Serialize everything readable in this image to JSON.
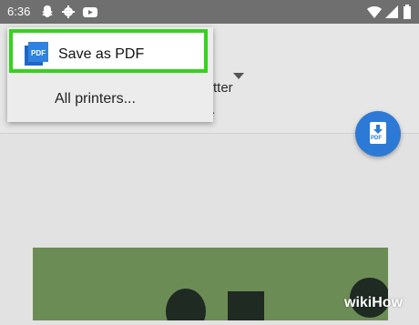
{
  "status_bar": {
    "time": "6:36",
    "icons": [
      "snapchat-icon",
      "gear-icon",
      "youtube-icon",
      "wifi-icon",
      "battery-icon",
      "signal-icon"
    ]
  },
  "toolbar": {
    "partial_paper_size": "tter",
    "partial_copies": "."
  },
  "menu": {
    "items": [
      {
        "label": "Save as PDF",
        "icon": "pdf-icon",
        "selected": true
      },
      {
        "label": "All printers..."
      }
    ]
  },
  "fab": {
    "label": "PDF",
    "icon": "download-pdf-icon"
  },
  "watermark": "wikiHow",
  "colors": {
    "highlight": "#33d41a",
    "fab": "#2d7ad6",
    "preview": "#6c8c55",
    "status_bar": "#6f6f6f"
  }
}
